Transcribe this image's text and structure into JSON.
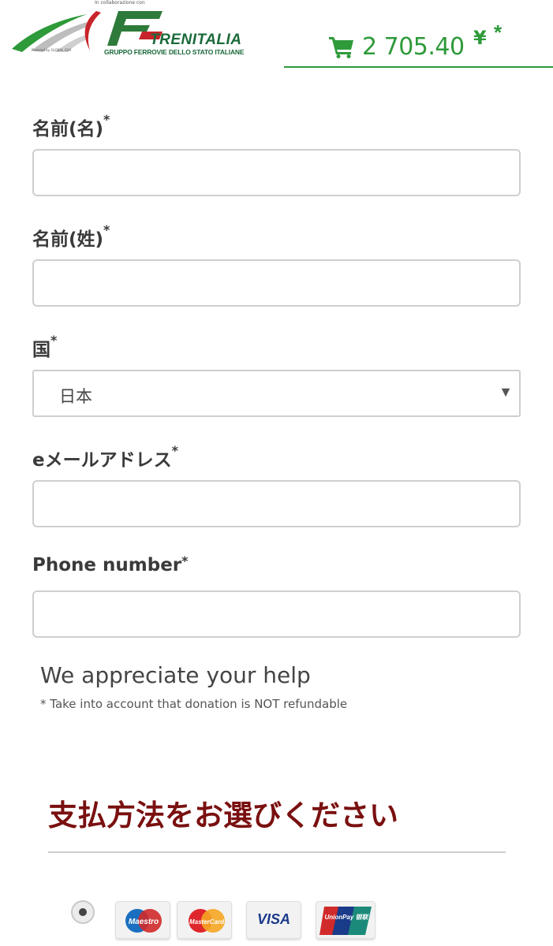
{
  "header": {
    "logo": {
      "collab_text": "In collaborazione con",
      "powered_text": "Powered by GLOBAL GSA",
      "brand": "TRENITALIA",
      "subtitle": "GRUPPO FERROVIE DELLO STATO ITALIANE"
    },
    "cart": {
      "icon": "shopping-cart-icon",
      "amount": "2 705.40",
      "currency": "¥",
      "required_marker": "*",
      "color": "#2e9a3a"
    }
  },
  "form": {
    "first_name": {
      "label": "名前(名)",
      "required": "*",
      "value": ""
    },
    "last_name": {
      "label": "名前(姓)",
      "required": "*",
      "value": ""
    },
    "country": {
      "label": "国",
      "required": "*",
      "selected": "日本"
    },
    "email": {
      "label": "eメールアドレス",
      "required": "*",
      "value": ""
    },
    "phone": {
      "label": "Phone number",
      "required": "*",
      "value": ""
    }
  },
  "donation": {
    "title": "We appreciate your help",
    "note": "* Take into account that donation is NOT refundable"
  },
  "payment": {
    "title": "支払方法をお選びください",
    "title_color": "#7a1010",
    "cards": [
      {
        "name": "Maestro",
        "icon": "maestro-icon"
      },
      {
        "name": "MasterCard",
        "icon": "mastercard-icon"
      },
      {
        "name": "VISA",
        "icon": "visa-icon"
      },
      {
        "name": "UnionPay 银联",
        "icon": "unionpay-icon"
      }
    ]
  }
}
